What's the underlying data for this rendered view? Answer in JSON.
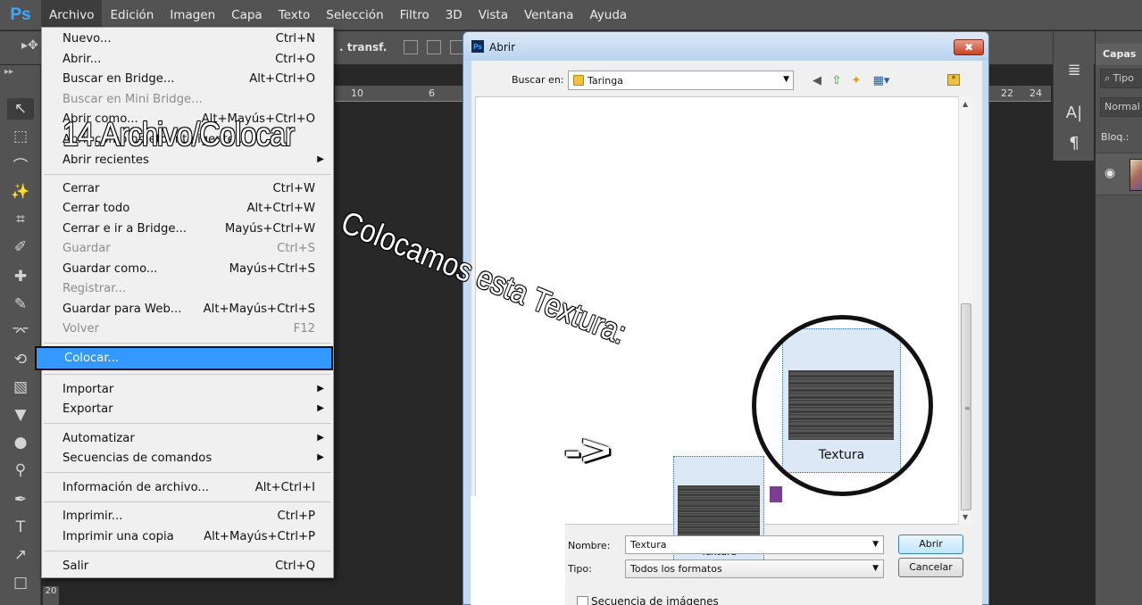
{
  "app": {
    "logo": "Ps",
    "menus": [
      "Archivo",
      "Edición",
      "Imagen",
      "Capa",
      "Texto",
      "Selección",
      "Filtro",
      "3D",
      "Vista",
      "Ventana",
      "Ayuda"
    ]
  },
  "options_bar": {
    "transf_label": ". transf."
  },
  "rulers": {
    "top": [
      "10",
      "6"
    ],
    "right": [
      "22",
      "24"
    ],
    "vertical": "20"
  },
  "layers_panel": {
    "tab": "Capas",
    "kind": "⌕ Tipo",
    "mode": "Normal",
    "lock": "Bloq.:"
  },
  "archivo_menu": {
    "items": [
      {
        "label": "Nuevo...",
        "shortcut": "Ctrl+N"
      },
      {
        "label": "Abrir...",
        "shortcut": "Ctrl+O"
      },
      {
        "label": "Buscar en Bridge...",
        "shortcut": "Alt+Ctrl+O"
      },
      {
        "label": "Buscar en Mini Bridge...",
        "shortcut": ""
      },
      {
        "label": "Abrir como...",
        "shortcut": "Alt+Mayús+Ctrl+O"
      },
      {
        "label": "Abrir como objeto inteligente...",
        "shortcut": ""
      },
      {
        "label": "Abrir recientes",
        "shortcut": ""
      },
      {
        "label": "Cerrar",
        "shortcut": "Ctrl+W"
      },
      {
        "label": "Cerrar todo",
        "shortcut": "Alt+Ctrl+W"
      },
      {
        "label": "Cerrar e ir a Bridge...",
        "shortcut": "Mayús+Ctrl+W"
      },
      {
        "label": "Guardar",
        "shortcut": "Ctrl+S"
      },
      {
        "label": "Guardar como...",
        "shortcut": "Mayús+Ctrl+S"
      },
      {
        "label": "Registrar...",
        "shortcut": ""
      },
      {
        "label": "Guardar para Web...",
        "shortcut": "Alt+Mayús+Ctrl+S"
      },
      {
        "label": "Volver",
        "shortcut": "F12"
      },
      {
        "label": "Colocar...",
        "shortcut": ""
      },
      {
        "label": "Importar",
        "shortcut": ""
      },
      {
        "label": "Exportar",
        "shortcut": ""
      },
      {
        "label": "Automatizar",
        "shortcut": ""
      },
      {
        "label": "Secuencias de comandos",
        "shortcut": ""
      },
      {
        "label": "Información de archivo...",
        "shortcut": "Alt+Ctrl+I"
      },
      {
        "label": "Imprimir...",
        "shortcut": "Ctrl+P"
      },
      {
        "label": "Imprimir una copia",
        "shortcut": "Alt+Mayús+Ctrl+P"
      },
      {
        "label": "Salir",
        "shortcut": "Ctrl+Q"
      }
    ]
  },
  "dialog": {
    "title": "Abrir",
    "close": "✖",
    "look_in_label": "Buscar en:",
    "look_in_value": "Taringa",
    "file_name": "Textura",
    "name_label": "Nombre:",
    "name_value": "Textura",
    "type_label": "Tipo:",
    "type_value": "Todos los formatos",
    "open_button": "Abrir",
    "cancel_button": "Cancelar",
    "sequence_label": "Secuencia de imágenes"
  },
  "overlay": {
    "step_title": "14.Archivo/Colocar",
    "callout": "Colocamos esta Textura:",
    "arrow": "->",
    "magnified_name": "Textura"
  }
}
